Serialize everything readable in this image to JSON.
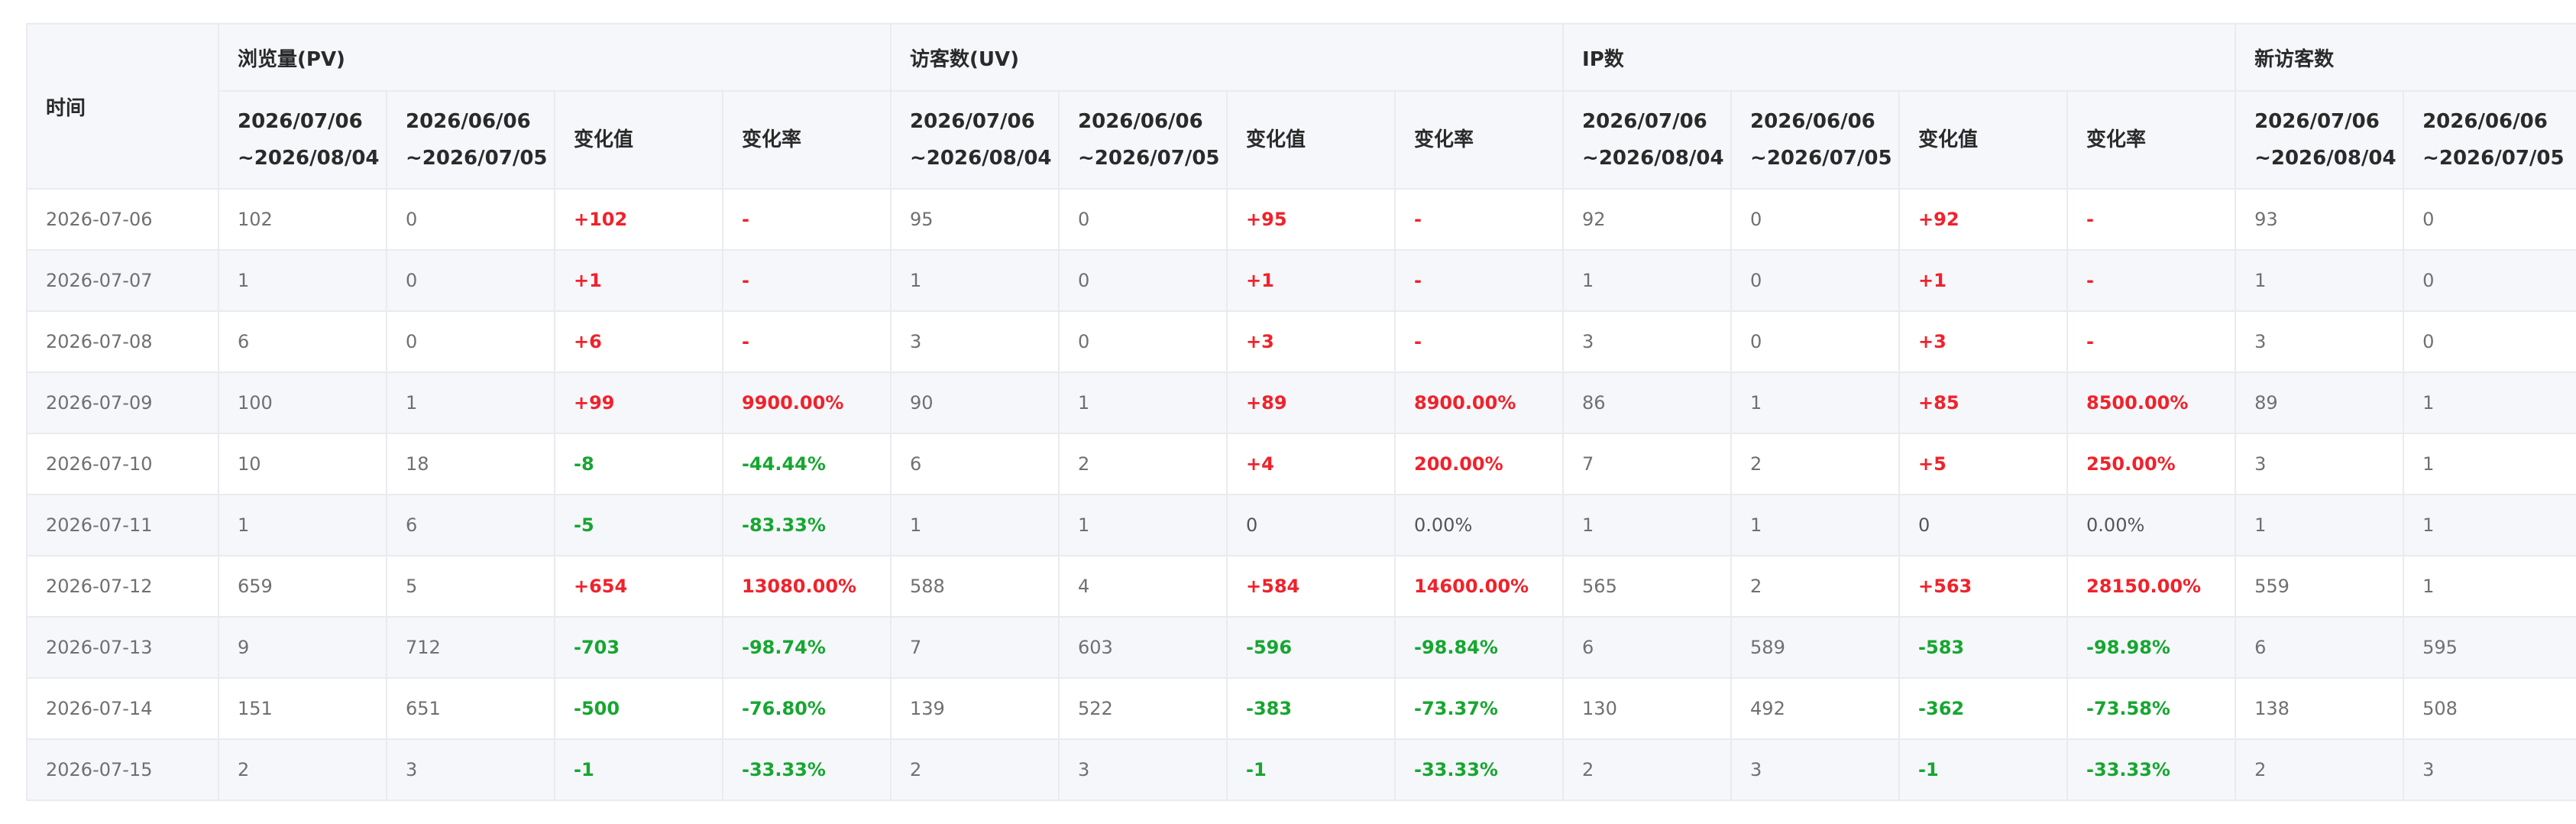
{
  "table": {
    "time_header": "时间",
    "groups": [
      "浏览量(PV)",
      "访客数(UV)",
      "IP数",
      "新访客数"
    ],
    "sub_headers": {
      "current_period_line1": "2026/07/06",
      "current_period_line2": "~2026/08/04",
      "previous_period_line1": "2026/06/06",
      "previous_period_line2": "~2026/07/05",
      "change_value": "变化值",
      "change_rate": "变化率"
    },
    "rows": [
      {
        "date": "2026-07-06",
        "cells": [
          {
            "text": "102",
            "tone": "plain"
          },
          {
            "text": "0",
            "tone": "plain"
          },
          {
            "text": "+102",
            "tone": "up"
          },
          {
            "text": "-",
            "tone": "up"
          },
          {
            "text": "95",
            "tone": "plain"
          },
          {
            "text": "0",
            "tone": "plain"
          },
          {
            "text": "+95",
            "tone": "up"
          },
          {
            "text": "-",
            "tone": "up"
          },
          {
            "text": "92",
            "tone": "plain"
          },
          {
            "text": "0",
            "tone": "plain"
          },
          {
            "text": "+92",
            "tone": "up"
          },
          {
            "text": "-",
            "tone": "up"
          },
          {
            "text": "93",
            "tone": "plain"
          },
          {
            "text": "0",
            "tone": "plain"
          }
        ]
      },
      {
        "date": "2026-07-07",
        "cells": [
          {
            "text": "1",
            "tone": "plain"
          },
          {
            "text": "0",
            "tone": "plain"
          },
          {
            "text": "+1",
            "tone": "up"
          },
          {
            "text": "-",
            "tone": "up"
          },
          {
            "text": "1",
            "tone": "plain"
          },
          {
            "text": "0",
            "tone": "plain"
          },
          {
            "text": "+1",
            "tone": "up"
          },
          {
            "text": "-",
            "tone": "up"
          },
          {
            "text": "1",
            "tone": "plain"
          },
          {
            "text": "0",
            "tone": "plain"
          },
          {
            "text": "+1",
            "tone": "up"
          },
          {
            "text": "-",
            "tone": "up"
          },
          {
            "text": "1",
            "tone": "plain"
          },
          {
            "text": "0",
            "tone": "plain"
          }
        ]
      },
      {
        "date": "2026-07-08",
        "cells": [
          {
            "text": "6",
            "tone": "plain"
          },
          {
            "text": "0",
            "tone": "plain"
          },
          {
            "text": "+6",
            "tone": "up"
          },
          {
            "text": "-",
            "tone": "up"
          },
          {
            "text": "3",
            "tone": "plain"
          },
          {
            "text": "0",
            "tone": "plain"
          },
          {
            "text": "+3",
            "tone": "up"
          },
          {
            "text": "-",
            "tone": "up"
          },
          {
            "text": "3",
            "tone": "plain"
          },
          {
            "text": "0",
            "tone": "plain"
          },
          {
            "text": "+3",
            "tone": "up"
          },
          {
            "text": "-",
            "tone": "up"
          },
          {
            "text": "3",
            "tone": "plain"
          },
          {
            "text": "0",
            "tone": "plain"
          }
        ]
      },
      {
        "date": "2026-07-09",
        "cells": [
          {
            "text": "100",
            "tone": "plain"
          },
          {
            "text": "1",
            "tone": "plain"
          },
          {
            "text": "+99",
            "tone": "up"
          },
          {
            "text": "9900.00%",
            "tone": "up"
          },
          {
            "text": "90",
            "tone": "plain"
          },
          {
            "text": "1",
            "tone": "plain"
          },
          {
            "text": "+89",
            "tone": "up"
          },
          {
            "text": "8900.00%",
            "tone": "up"
          },
          {
            "text": "86",
            "tone": "plain"
          },
          {
            "text": "1",
            "tone": "plain"
          },
          {
            "text": "+85",
            "tone": "up"
          },
          {
            "text": "8500.00%",
            "tone": "up"
          },
          {
            "text": "89",
            "tone": "plain"
          },
          {
            "text": "1",
            "tone": "plain"
          }
        ]
      },
      {
        "date": "2026-07-10",
        "cells": [
          {
            "text": "10",
            "tone": "plain"
          },
          {
            "text": "18",
            "tone": "plain"
          },
          {
            "text": "-8",
            "tone": "down"
          },
          {
            "text": "-44.44%",
            "tone": "down"
          },
          {
            "text": "6",
            "tone": "plain"
          },
          {
            "text": "2",
            "tone": "plain"
          },
          {
            "text": "+4",
            "tone": "up"
          },
          {
            "text": "200.00%",
            "tone": "up"
          },
          {
            "text": "7",
            "tone": "plain"
          },
          {
            "text": "2",
            "tone": "plain"
          },
          {
            "text": "+5",
            "tone": "up"
          },
          {
            "text": "250.00%",
            "tone": "up"
          },
          {
            "text": "3",
            "tone": "plain"
          },
          {
            "text": "1",
            "tone": "plain"
          }
        ]
      },
      {
        "date": "2026-07-11",
        "cells": [
          {
            "text": "1",
            "tone": "plain"
          },
          {
            "text": "6",
            "tone": "plain"
          },
          {
            "text": "-5",
            "tone": "down"
          },
          {
            "text": "-83.33%",
            "tone": "down"
          },
          {
            "text": "1",
            "tone": "plain"
          },
          {
            "text": "1",
            "tone": "plain"
          },
          {
            "text": "0",
            "tone": "flat"
          },
          {
            "text": "0.00%",
            "tone": "flat"
          },
          {
            "text": "1",
            "tone": "plain"
          },
          {
            "text": "1",
            "tone": "plain"
          },
          {
            "text": "0",
            "tone": "flat"
          },
          {
            "text": "0.00%",
            "tone": "flat"
          },
          {
            "text": "1",
            "tone": "plain"
          },
          {
            "text": "1",
            "tone": "plain"
          }
        ]
      },
      {
        "date": "2026-07-12",
        "cells": [
          {
            "text": "659",
            "tone": "plain"
          },
          {
            "text": "5",
            "tone": "plain"
          },
          {
            "text": "+654",
            "tone": "up"
          },
          {
            "text": "13080.00%",
            "tone": "up"
          },
          {
            "text": "588",
            "tone": "plain"
          },
          {
            "text": "4",
            "tone": "plain"
          },
          {
            "text": "+584",
            "tone": "up"
          },
          {
            "text": "14600.00%",
            "tone": "up"
          },
          {
            "text": "565",
            "tone": "plain"
          },
          {
            "text": "2",
            "tone": "plain"
          },
          {
            "text": "+563",
            "tone": "up"
          },
          {
            "text": "28150.00%",
            "tone": "up"
          },
          {
            "text": "559",
            "tone": "plain"
          },
          {
            "text": "1",
            "tone": "plain"
          }
        ]
      },
      {
        "date": "2026-07-13",
        "cells": [
          {
            "text": "9",
            "tone": "plain"
          },
          {
            "text": "712",
            "tone": "plain"
          },
          {
            "text": "-703",
            "tone": "down"
          },
          {
            "text": "-98.74%",
            "tone": "down"
          },
          {
            "text": "7",
            "tone": "plain"
          },
          {
            "text": "603",
            "tone": "plain"
          },
          {
            "text": "-596",
            "tone": "down"
          },
          {
            "text": "-98.84%",
            "tone": "down"
          },
          {
            "text": "6",
            "tone": "plain"
          },
          {
            "text": "589",
            "tone": "plain"
          },
          {
            "text": "-583",
            "tone": "down"
          },
          {
            "text": "-98.98%",
            "tone": "down"
          },
          {
            "text": "6",
            "tone": "plain"
          },
          {
            "text": "595",
            "tone": "plain"
          }
        ]
      },
      {
        "date": "2026-07-14",
        "cells": [
          {
            "text": "151",
            "tone": "plain"
          },
          {
            "text": "651",
            "tone": "plain"
          },
          {
            "text": "-500",
            "tone": "down"
          },
          {
            "text": "-76.80%",
            "tone": "down"
          },
          {
            "text": "139",
            "tone": "plain"
          },
          {
            "text": "522",
            "tone": "plain"
          },
          {
            "text": "-383",
            "tone": "down"
          },
          {
            "text": "-73.37%",
            "tone": "down"
          },
          {
            "text": "130",
            "tone": "plain"
          },
          {
            "text": "492",
            "tone": "plain"
          },
          {
            "text": "-362",
            "tone": "down"
          },
          {
            "text": "-73.58%",
            "tone": "down"
          },
          {
            "text": "138",
            "tone": "plain"
          },
          {
            "text": "508",
            "tone": "plain"
          }
        ]
      },
      {
        "date": "2026-07-15",
        "cells": [
          {
            "text": "2",
            "tone": "plain"
          },
          {
            "text": "3",
            "tone": "plain"
          },
          {
            "text": "-1",
            "tone": "down"
          },
          {
            "text": "-33.33%",
            "tone": "down"
          },
          {
            "text": "2",
            "tone": "plain"
          },
          {
            "text": "3",
            "tone": "plain"
          },
          {
            "text": "-1",
            "tone": "down"
          },
          {
            "text": "-33.33%",
            "tone": "down"
          },
          {
            "text": "2",
            "tone": "plain"
          },
          {
            "text": "3",
            "tone": "plain"
          },
          {
            "text": "-1",
            "tone": "down"
          },
          {
            "text": "-33.33%",
            "tone": "down"
          },
          {
            "text": "2",
            "tone": "plain"
          },
          {
            "text": "3",
            "tone": "plain"
          }
        ]
      }
    ]
  },
  "colors": {
    "increase": "#f0222b",
    "decrease": "#17a631",
    "header_bg": "#f5f7fa",
    "border": "#e9ebef"
  }
}
